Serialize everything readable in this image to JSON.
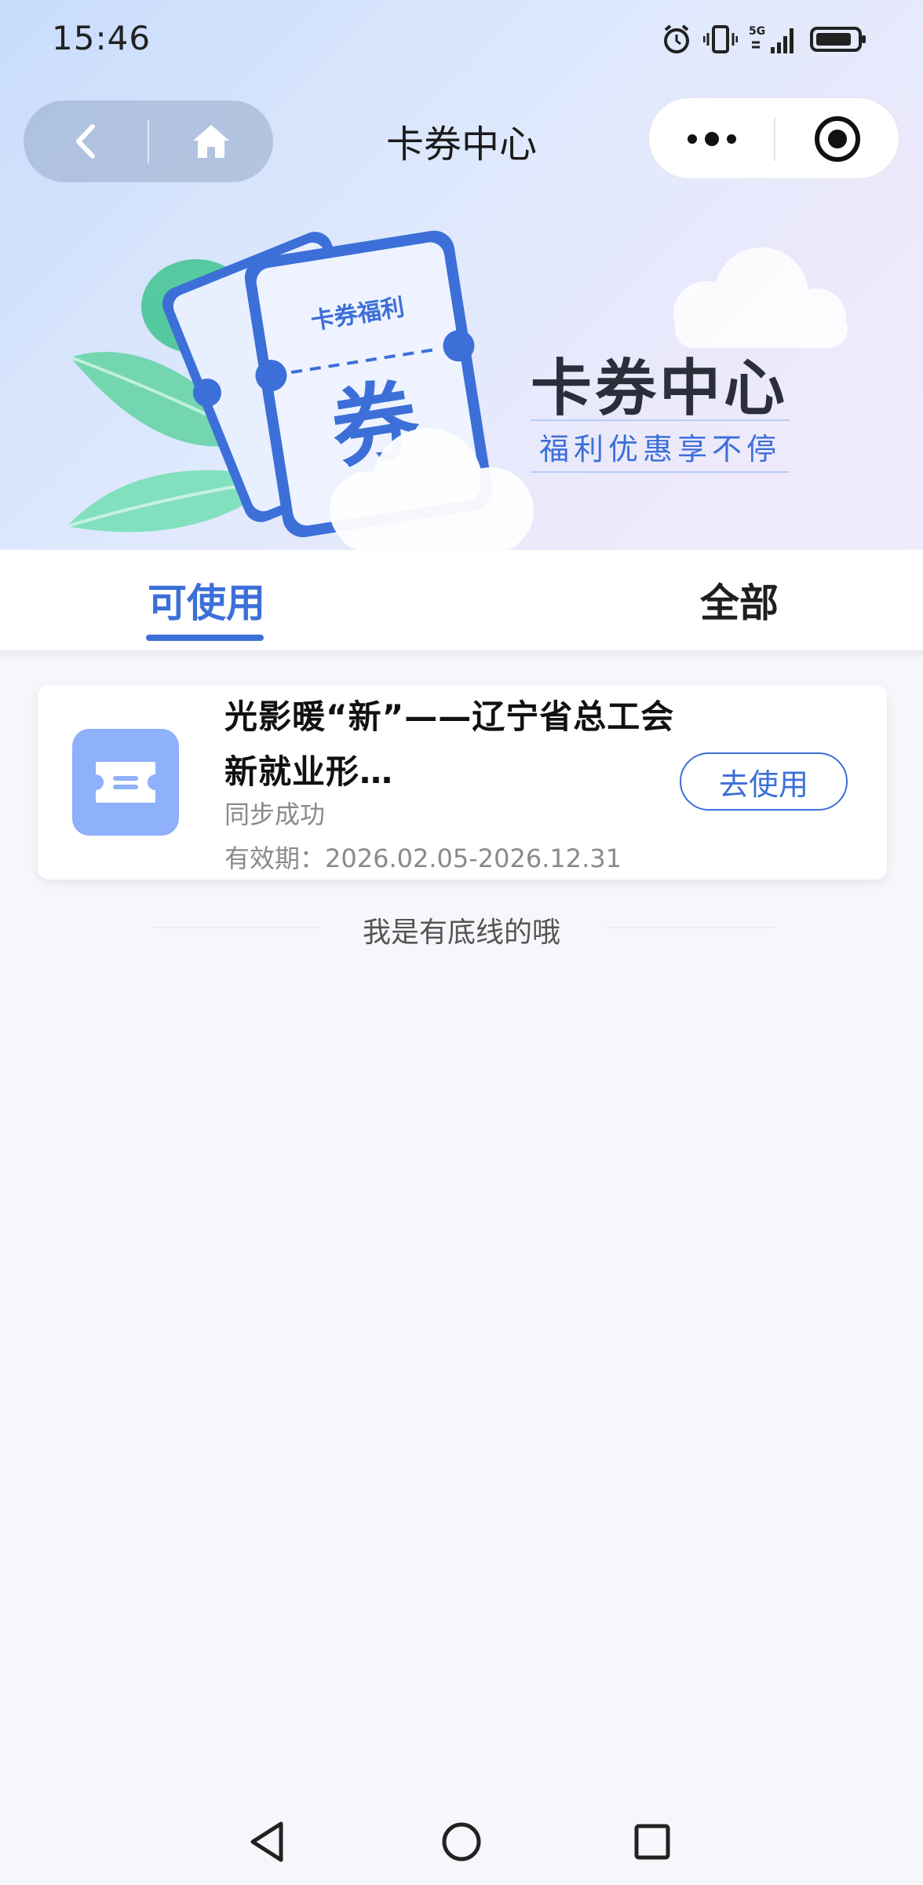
{
  "status_bar": {
    "time": "15:46",
    "icons": [
      "alarm-icon",
      "vibrate-icon",
      "5g-signal-icon",
      "battery-icon"
    ],
    "network_label": "5G"
  },
  "nav_bar": {
    "title": "卡券中心",
    "back_icon": "chevron-left-icon",
    "home_icon": "home-icon",
    "more_icon": "more-dots-icon",
    "close_icon": "target-circle-icon"
  },
  "hero": {
    "ticket_label": "卡券福利",
    "ticket_glyph": "券",
    "title": "卡券中心",
    "subtitle": "福利优惠享不停"
  },
  "tabs": [
    {
      "label": "可使用",
      "active": true
    },
    {
      "label": "全部",
      "active": false
    }
  ],
  "coupons": [
    {
      "title": "光影暖“新”——辽宁省总工会新就业形…",
      "status": "同步成功",
      "validity": "有效期：2026.02.05-2026.12.31",
      "action_label": "去使用",
      "icon": "ticket-icon"
    }
  ],
  "footer_text": "我是有底线的哦",
  "colors": {
    "accent": "#3C6FD8",
    "icon_bg": "#8FB0FB",
    "page_bg": "#F5F7FB"
  },
  "android_nav": [
    "back-triangle-icon",
    "home-circle-icon",
    "recents-square-icon"
  ]
}
